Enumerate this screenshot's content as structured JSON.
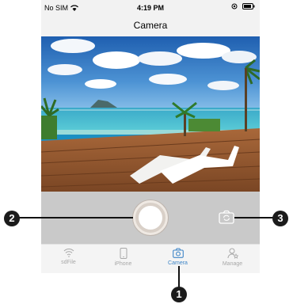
{
  "status_bar": {
    "carrier": "No SIM",
    "time": "4:19 PM"
  },
  "nav": {
    "title": "Camera"
  },
  "tabs": [
    {
      "label": "sdFile",
      "icon": "wifi-icon",
      "active": false
    },
    {
      "label": "iPhone",
      "icon": "iphone-icon",
      "active": false
    },
    {
      "label": "Camera",
      "icon": "camera-icon",
      "active": true
    },
    {
      "label": "Manage",
      "icon": "manage-user-icon",
      "active": false
    }
  ],
  "callouts": {
    "one": "1",
    "two": "2",
    "three": "3"
  },
  "colors": {
    "accent": "#3f86c7",
    "tab_inactive": "#a8a8a8",
    "controls_bg": "#c9c9c9"
  }
}
